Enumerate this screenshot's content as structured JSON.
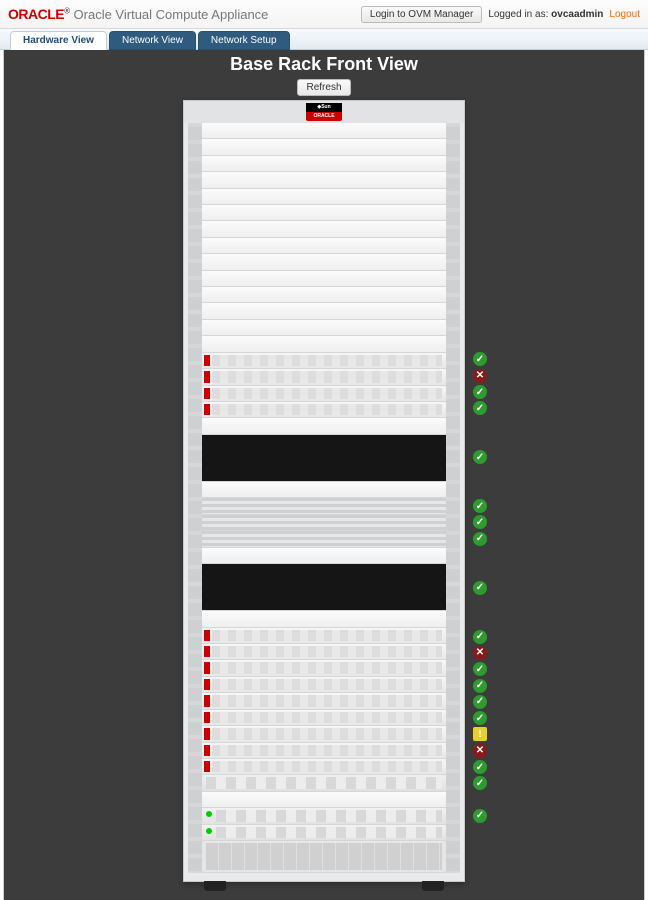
{
  "header": {
    "brand": "ORACLE",
    "app_name": "Oracle Virtual Compute Appliance",
    "login_button": "Login to OVM Manager",
    "logged_in_prefix": "Logged in as:",
    "user": "ovcaadmin",
    "logout": "Logout"
  },
  "tabs": [
    {
      "label": "Hardware View",
      "active": true
    },
    {
      "label": "Network View",
      "active": false
    },
    {
      "label": "Network Setup",
      "active": false
    }
  ],
  "page": {
    "title": "Base Rack Front View",
    "refresh": "Refresh",
    "sun_badge_top": "◆Sun",
    "sun_badge_bottom": "ORACLE"
  },
  "rack_slots": [
    {
      "type": "empty",
      "u": 1
    },
    {
      "type": "empty",
      "u": 1
    },
    {
      "type": "empty",
      "u": 1
    },
    {
      "type": "empty",
      "u": 1
    },
    {
      "type": "empty",
      "u": 1
    },
    {
      "type": "empty",
      "u": 1
    },
    {
      "type": "empty",
      "u": 1
    },
    {
      "type": "empty",
      "u": 1
    },
    {
      "type": "empty",
      "u": 1
    },
    {
      "type": "empty",
      "u": 1
    },
    {
      "type": "empty",
      "u": 1
    },
    {
      "type": "empty",
      "u": 1
    },
    {
      "type": "empty",
      "u": 1
    },
    {
      "type": "empty",
      "u": 1
    },
    {
      "type": "unit-a",
      "u": 1,
      "status": "ok"
    },
    {
      "type": "unit-a",
      "u": 1,
      "status": "err"
    },
    {
      "type": "unit-a",
      "u": 1,
      "status": "ok"
    },
    {
      "type": "unit-a",
      "u": 1,
      "status": "ok"
    },
    {
      "type": "empty",
      "u": 1
    },
    {
      "type": "black",
      "u": 3,
      "status": "ok"
    },
    {
      "type": "empty",
      "u": 1
    },
    {
      "type": "grill",
      "u": 1,
      "status": "ok"
    },
    {
      "type": "grill",
      "u": 1,
      "status": "ok"
    },
    {
      "type": "grill",
      "u": 1,
      "status": "ok"
    },
    {
      "type": "empty",
      "u": 1
    },
    {
      "type": "black",
      "u": 3,
      "status": "ok"
    },
    {
      "type": "empty",
      "u": 1
    },
    {
      "type": "unit-a",
      "u": 1,
      "status": "ok"
    },
    {
      "type": "unit-a",
      "u": 1,
      "status": "err"
    },
    {
      "type": "unit-a",
      "u": 1,
      "status": "ok"
    },
    {
      "type": "unit-a",
      "u": 1,
      "status": "ok"
    },
    {
      "type": "unit-a",
      "u": 1,
      "status": "ok"
    },
    {
      "type": "unit-a",
      "u": 1,
      "status": "ok"
    },
    {
      "type": "unit-a",
      "u": 1,
      "status": "warn"
    },
    {
      "type": "unit-a",
      "u": 1,
      "status": "err"
    },
    {
      "type": "unit-a",
      "u": 1,
      "status": "ok"
    },
    {
      "type": "unit-b",
      "u": 1,
      "status": "ok"
    },
    {
      "type": "empty",
      "u": 1
    },
    {
      "type": "mgmt",
      "u": 1,
      "status": "ok"
    },
    {
      "type": "mgmt",
      "u": 1
    },
    {
      "type": "storage",
      "u": 2
    }
  ],
  "status_glyph": {
    "ok": "✓",
    "err": "✕",
    "warn": "!"
  }
}
